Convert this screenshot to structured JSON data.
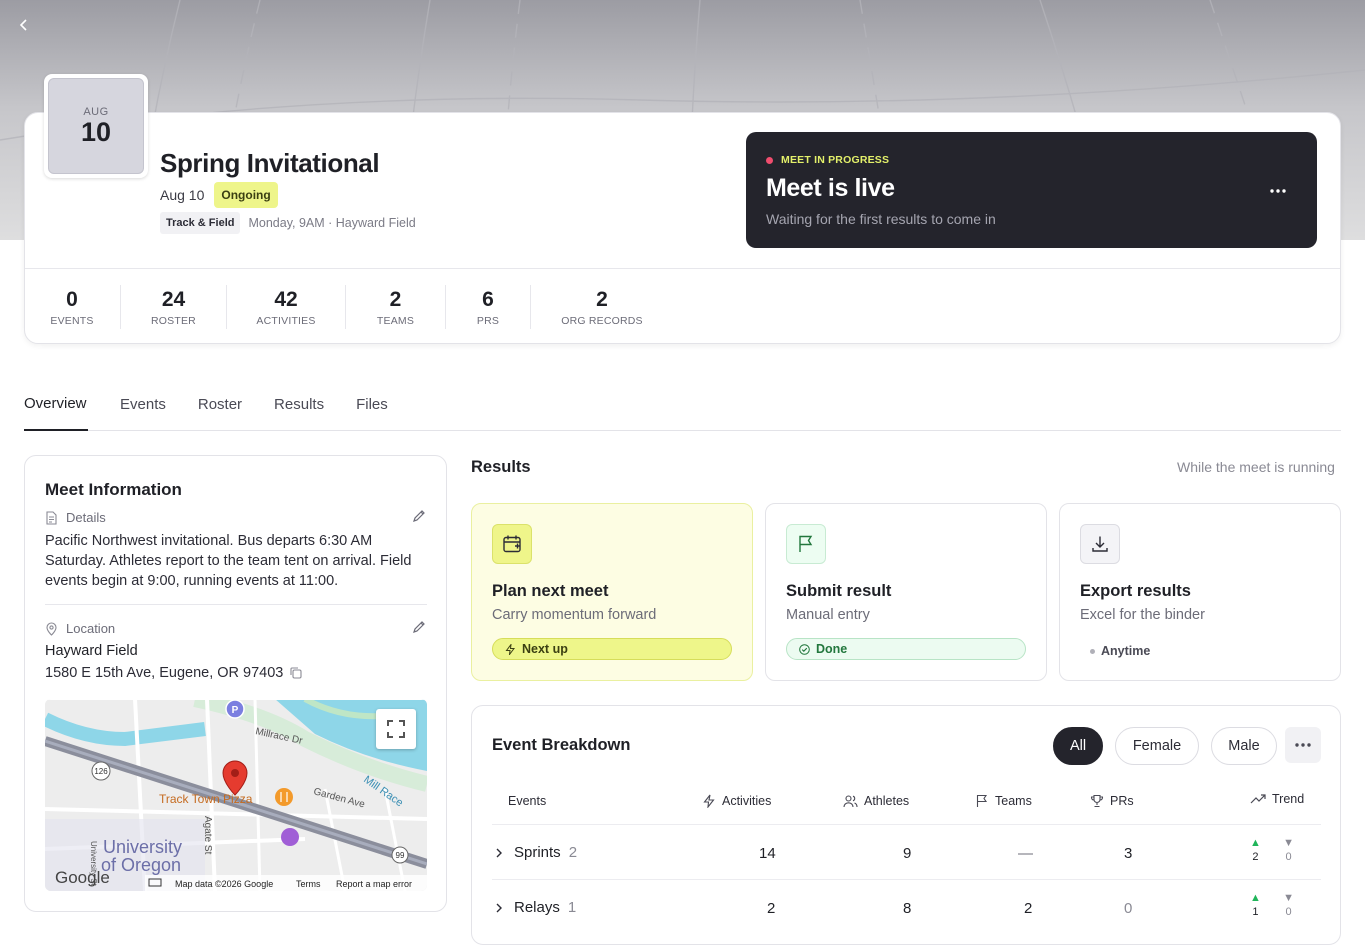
{
  "meet": {
    "month": "AUG",
    "day": "10",
    "title": "Spring Invitational",
    "date": "Aug 10",
    "status": "Ongoing",
    "sport": "Track & Field",
    "when_where": "Monday, 9AM · Hayward Field"
  },
  "live": {
    "label": "MEET IN PROGRESS",
    "heading": "Meet is live",
    "subtitle": "Waiting for the first results to come in"
  },
  "stats": [
    {
      "value": "0",
      "label": "EVENTS"
    },
    {
      "value": "24",
      "label": "ROSTER"
    },
    {
      "value": "42",
      "label": "ACTIVITIES"
    },
    {
      "value": "2",
      "label": "TEAMS"
    },
    {
      "value": "6",
      "label": "PRS"
    },
    {
      "value": "2",
      "label": "ORG RECORDS"
    }
  ],
  "tabs": [
    "Overview",
    "Events",
    "Roster",
    "Results",
    "Files"
  ],
  "meet_info": {
    "title": "Meet Information",
    "details_label": "Details",
    "details": "Pacific Northwest invitational. Bus departs 6:30 AM Saturday. Athletes report to the team tent on arrival. Field events begin at 9:00, running events at 11:00.",
    "location_label": "Location",
    "location_name": "Hayward Field",
    "address": "1580 E 15th Ave, Eugene, OR 97403"
  },
  "map": {
    "streets": [
      "Millrace Dr",
      "Garden Ave",
      "Mill Race",
      "Agate St",
      "University St"
    ],
    "place": "Track Town Pizza",
    "campus": [
      "University",
      "of Oregon"
    ],
    "shields": [
      "126",
      "99"
    ],
    "parking": "P",
    "brand": "Google",
    "footer": [
      "Map data ©2026 Google",
      "Terms",
      "Report a map error"
    ]
  },
  "results": {
    "title": "Results",
    "note": "While the meet is running",
    "actions": [
      {
        "title": "Plan next meet",
        "sub": "Carry momentum forward",
        "pill": "Next up"
      },
      {
        "title": "Submit result",
        "sub": "Manual entry",
        "pill": "Done"
      },
      {
        "title": "Export results",
        "sub": "Excel for the binder",
        "pill": "Anytime"
      }
    ]
  },
  "breakdown": {
    "title": "Event Breakdown",
    "filters": [
      "All",
      "Female",
      "Male"
    ],
    "columns": [
      "Events",
      "Activities",
      "Athletes",
      "Teams",
      "PRs",
      "Trend"
    ],
    "rows": [
      {
        "name": "Sprints",
        "count": "2",
        "activities": "14",
        "athletes": "9",
        "teams": "—",
        "prs": "3",
        "up": "2",
        "down": "0"
      },
      {
        "name": "Relays",
        "count": "1",
        "activities": "2",
        "athletes": "8",
        "teams": "2",
        "prs": "0",
        "up": "1",
        "down": "0"
      }
    ]
  },
  "colors": {
    "accent_yellow": "#eef58a",
    "dark": "#24242c",
    "live_dot": "#f04d6e",
    "success": "#20b55a"
  }
}
